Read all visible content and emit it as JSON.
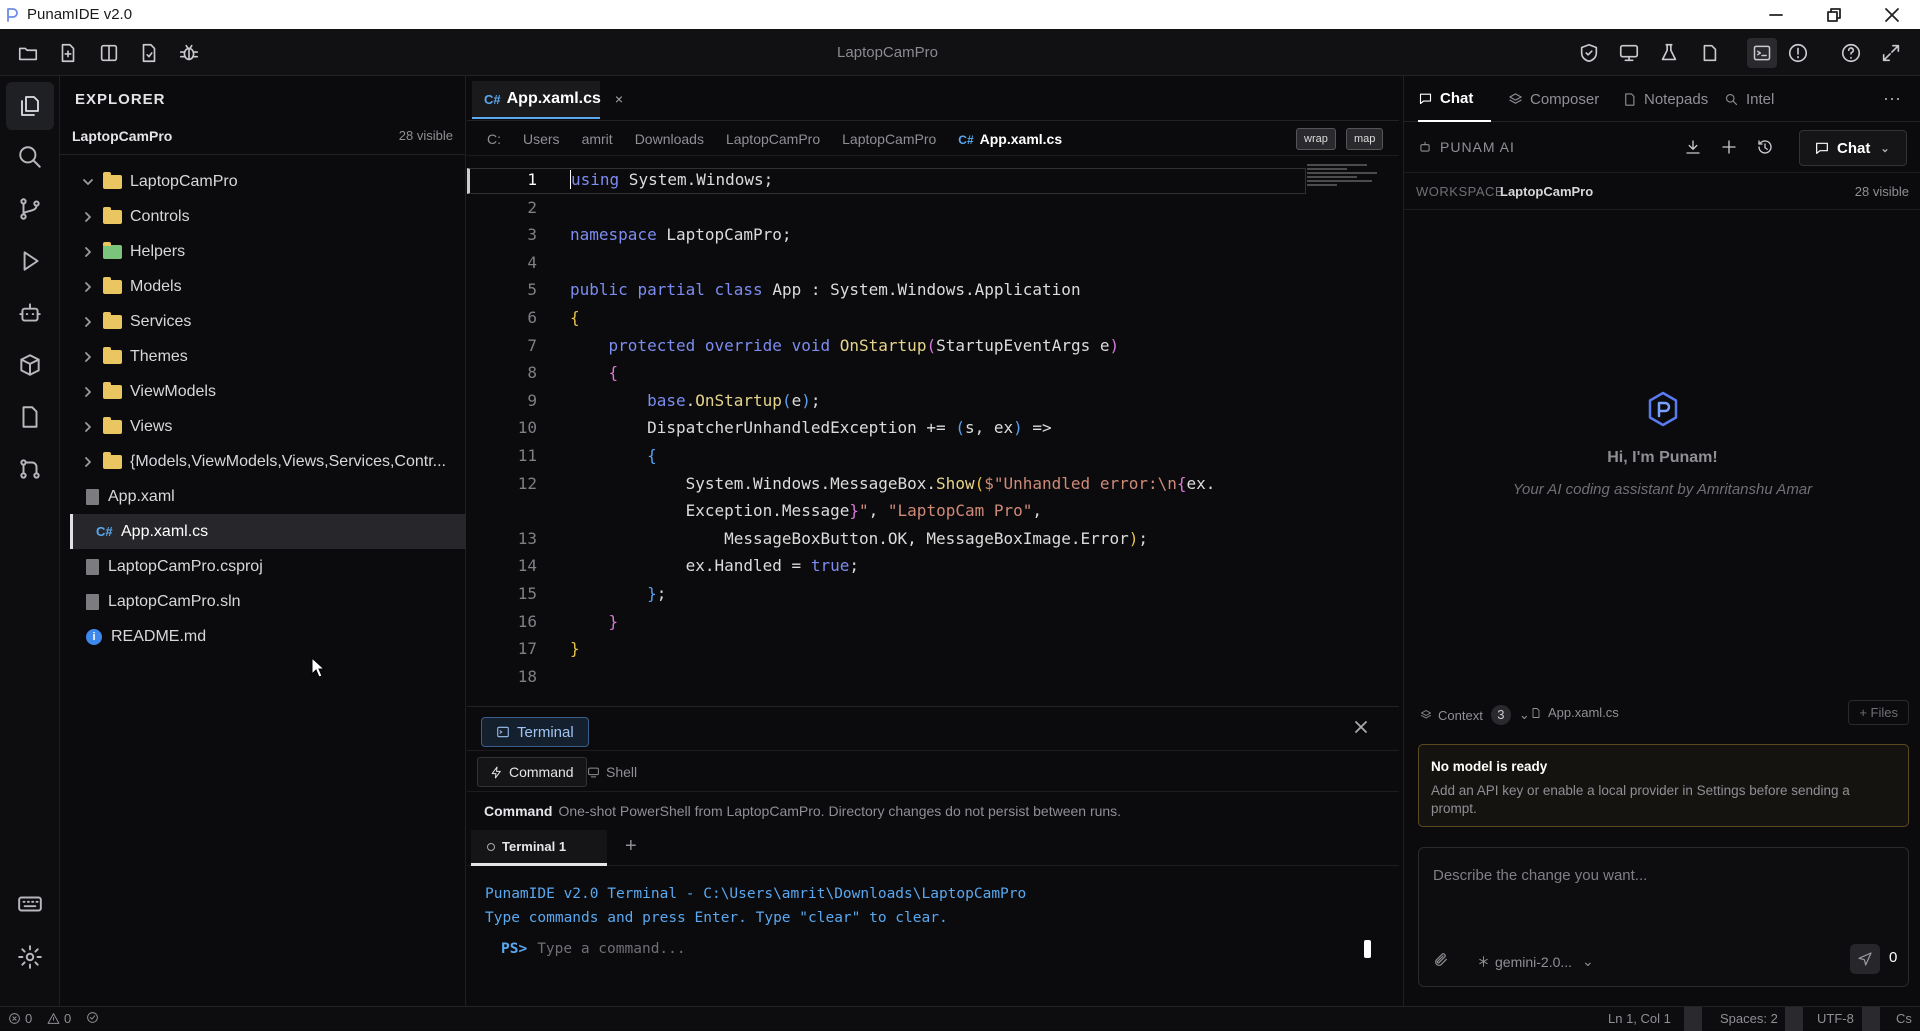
{
  "window": {
    "title": "PunamIDE v2.0"
  },
  "toolbar": {
    "project": "LaptopCamPro"
  },
  "explorer": {
    "header": "EXPLORER",
    "root": "LaptopCamPro",
    "count": "28 visible",
    "items": [
      {
        "label": "LaptopCamPro",
        "kind": "folder-open"
      },
      {
        "label": "Controls",
        "kind": "folder"
      },
      {
        "label": "Helpers",
        "kind": "folder"
      },
      {
        "label": "Models",
        "kind": "folder"
      },
      {
        "label": "Services",
        "kind": "folder"
      },
      {
        "label": "Themes",
        "kind": "folder"
      },
      {
        "label": "ViewModels",
        "kind": "folder"
      },
      {
        "label": "Views",
        "kind": "folder"
      },
      {
        "label": "{Models,ViewModels,Views,Services,Contr...",
        "kind": "folder"
      },
      {
        "label": "App.xaml",
        "kind": "file"
      },
      {
        "label": "App.xaml.cs",
        "kind": "cs-file",
        "selected": true
      },
      {
        "label": "LaptopCamPro.csproj",
        "kind": "file"
      },
      {
        "label": "LaptopCamPro.sln",
        "kind": "file"
      },
      {
        "label": "README.md",
        "kind": "info-file"
      }
    ]
  },
  "editor": {
    "tab": {
      "icon": "C#",
      "label": "App.xaml.cs",
      "close": "×"
    },
    "breadcrumbs": [
      "C:",
      "Users",
      "amrit",
      "Downloads",
      "LaptopCamPro",
      "LaptopCamPro",
      "App.xaml.cs"
    ],
    "buttons": {
      "wrap": "wrap",
      "map": "map"
    },
    "current_line": 1,
    "lines": [
      {
        "n": "1",
        "html": "<span style='border-left:1px solid #fff'></span><span class='kb'>using</span> System.Windows;"
      },
      {
        "n": "2",
        "html": ""
      },
      {
        "n": "3",
        "html": "<span class='kb'>namespace</span> LaptopCamPro;"
      },
      {
        "n": "4",
        "html": ""
      },
      {
        "n": "5",
        "html": "<span class='kb'>public</span> <span class='kb'>partial</span> <span class='kb'>class</span> App : System.Windows.Application"
      },
      {
        "n": "6",
        "html": "<span class='br'>{</span>"
      },
      {
        "n": "7",
        "html": "    <span class='kb'>protected</span> <span class='kb'>override</span> <span class='kb'>void</span> <span class='fn'>OnStartup</span><span class='br2'>(</span>StartupEventArgs e<span class='br2'>)</span>"
      },
      {
        "n": "8",
        "html": "    <span class='br2'>{</span>"
      },
      {
        "n": "9",
        "html": "        <span class='kb'>base</span>.<span class='fn'>OnStartup</span><span class='br3'>(</span>e<span class='br3'>)</span>;"
      },
      {
        "n": "10",
        "html": "        DispatcherUnhandledException += <span class='br3'>(</span>s, ex<span class='br3'>)</span> =>"
      },
      {
        "n": "11",
        "html": "        <span class='br3'>{</span>"
      },
      {
        "n": "12",
        "html": "            System.Windows.MessageBox.<span class='fn'>Show</span><span class='br'>(</span><span class='s'>$\"Unhandled error:\\n</span><span class='br2'>{</span>ex."
      },
      {
        "n": "",
        "html": "            Exception.Message<span class='br2'>}</span><span class='s'>\"</span>, <span class='s'>\"LaptopCam Pro\"</span>,"
      },
      {
        "n": "13",
        "html": "                MessageBoxButton.OK, MessageBoxImage.Error<span class='br'>)</span>;"
      },
      {
        "n": "14",
        "html": "            ex.Handled = <span class='kb'>true</span>;"
      },
      {
        "n": "15",
        "html": "        <span class='br3'>}</span>;"
      },
      {
        "n": "16",
        "html": "    <span class='br2'>}</span>"
      },
      {
        "n": "17",
        "html": "<span class='br'>}</span>"
      },
      {
        "n": "18",
        "html": ""
      }
    ]
  },
  "terminal": {
    "title": "Terminal",
    "tabs": {
      "command": "Command",
      "shell": "Shell"
    },
    "info_label": "Command",
    "info_text": "One-shot PowerShell from LaptopCamPro. Directory changes do not persist between runs.",
    "session_tab": "Terminal 1",
    "add": "+",
    "output": [
      "PunamIDE v2.0 Terminal - C:\\Users\\amrit\\Downloads\\LaptopCamPro",
      "Type commands and press Enter. Type \"clear\" to clear."
    ],
    "prompt": "PS>",
    "placeholder": "Type a command..."
  },
  "chat": {
    "tabs": {
      "chat": "Chat",
      "composer": "Composer",
      "notepads": "Notepads",
      "intel": "Intel"
    },
    "more": "···",
    "panel_title": "PUNAM AI",
    "mode": "Chat",
    "workspace_label": "WORKSPACE",
    "workspace_name": "LaptopCamPro",
    "workspace_count": "28 visible",
    "greeting": "Hi, I'm Punam!",
    "subtitle": "Your AI coding assistant by Amritanshu Amar",
    "context_label": "Context",
    "context_count": "3",
    "context_file": "App.xaml.cs",
    "files_btn": "+ Files",
    "warning_title": "No model is ready",
    "warning_text": "Add an API key or enable a local provider in Settings before sending a prompt.",
    "input_placeholder": "Describe the change you want...",
    "model": "gemini-2.0...",
    "token_count": "0"
  },
  "status": {
    "errors": "0",
    "warnings": "0",
    "position": "Ln 1, Col 1",
    "spaces": "Spaces: 2",
    "encoding": "UTF-8",
    "lang": "Cs"
  },
  "colors": {
    "accent": "#5aa8ef",
    "folder": "#e9c660",
    "warning_border": "#5a4a20"
  }
}
